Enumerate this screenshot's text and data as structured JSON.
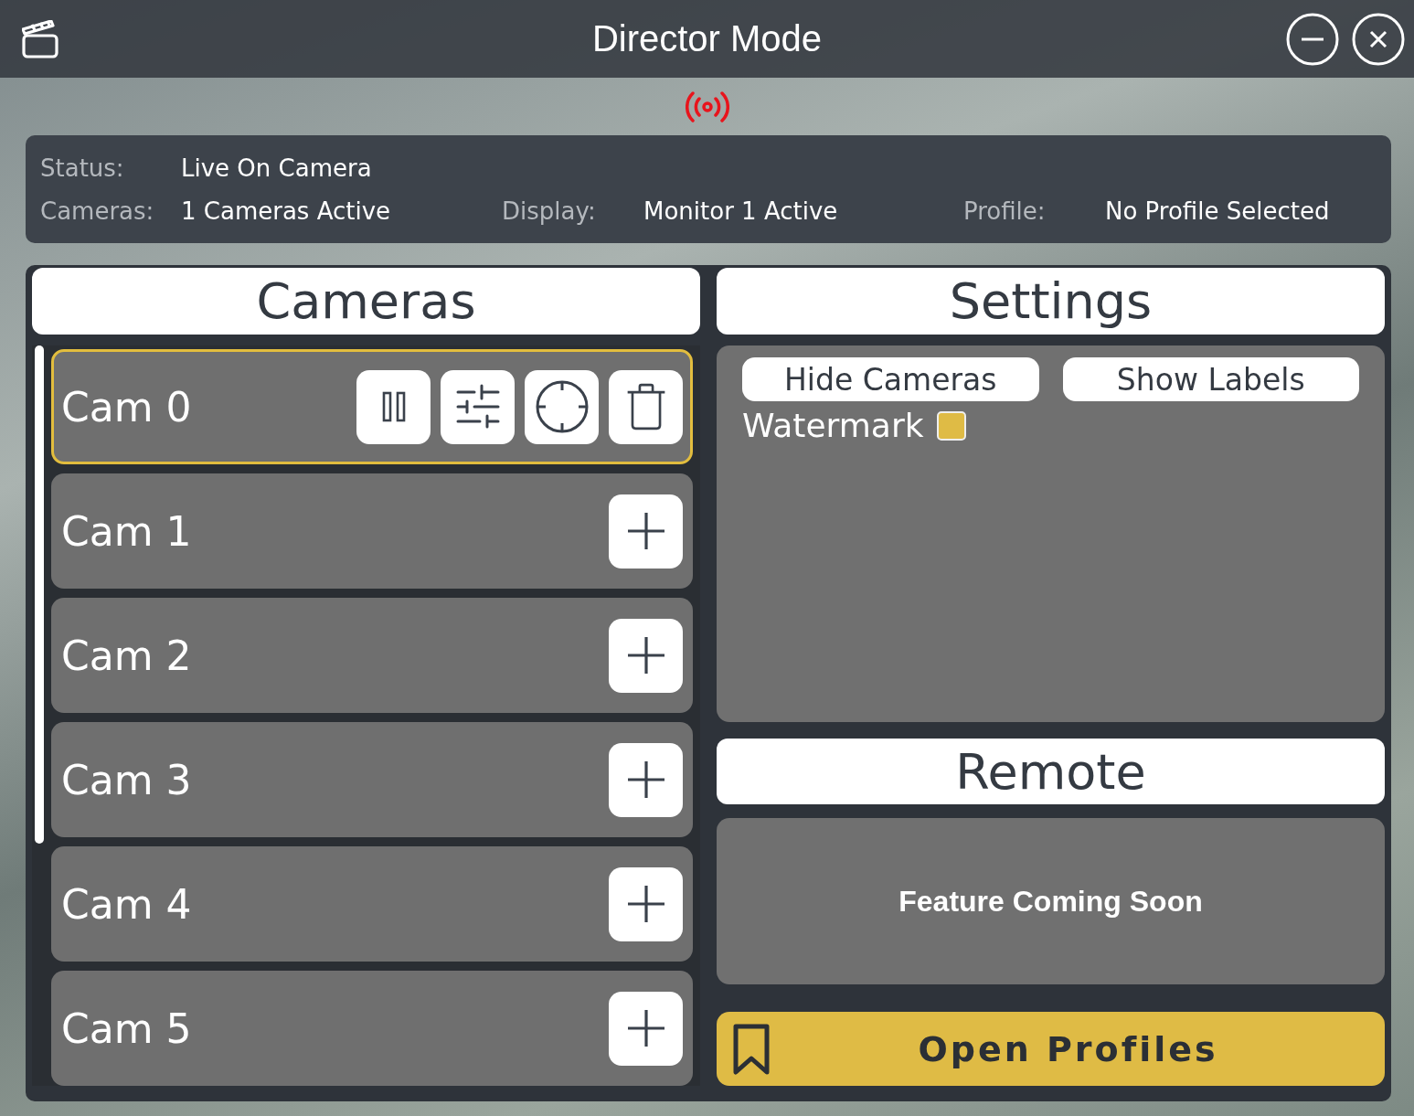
{
  "window": {
    "title": "Director Mode"
  },
  "status": {
    "rows": [
      {
        "fields": [
          {
            "label": "Status:",
            "value": "Live On Camera"
          }
        ]
      },
      {
        "fields": [
          {
            "label": "Cameras:",
            "value": "1 Cameras Active"
          },
          {
            "label": "Display:",
            "value": "Monitor 1 Active"
          },
          {
            "label": "Profile:",
            "value": "No Profile Selected"
          }
        ]
      }
    ]
  },
  "cameras": {
    "title": "Cameras",
    "items": [
      {
        "name": "Cam 0",
        "selected": true,
        "active": true
      },
      {
        "name": "Cam 1",
        "selected": false,
        "active": false
      },
      {
        "name": "Cam 2",
        "selected": false,
        "active": false
      },
      {
        "name": "Cam 3",
        "selected": false,
        "active": false
      },
      {
        "name": "Cam 4",
        "selected": false,
        "active": false
      },
      {
        "name": "Cam 5",
        "selected": false,
        "active": false
      }
    ]
  },
  "settings": {
    "title": "Settings",
    "buttons": [
      "Hide Cameras",
      "Show Labels"
    ],
    "watermark": {
      "label": "Watermark",
      "checked": true
    }
  },
  "remote": {
    "title": "Remote",
    "message": "Feature Coming Soon"
  },
  "open_profiles_button": {
    "label": "Open Profiles"
  }
}
